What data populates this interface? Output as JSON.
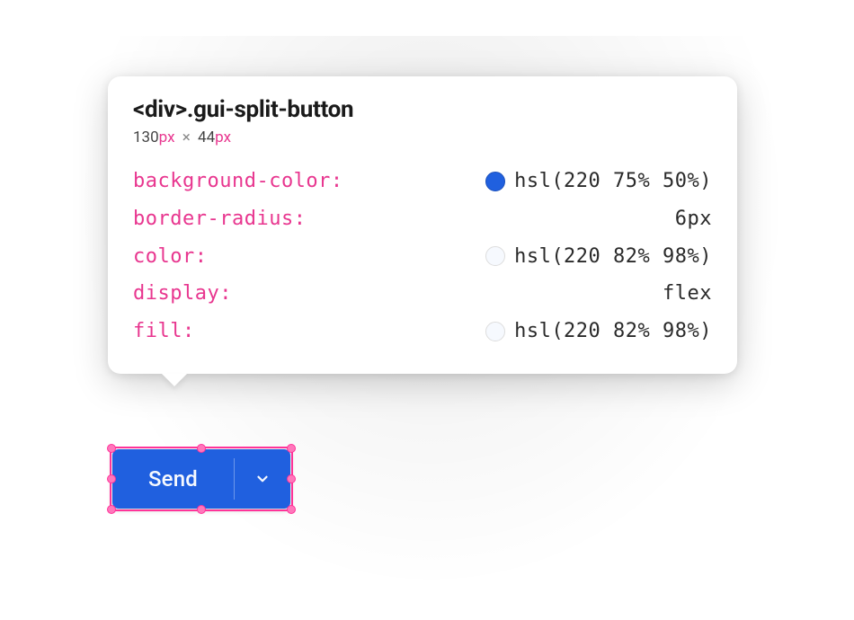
{
  "tooltip": {
    "selector": "<div>.gui-split-button",
    "width_num": "130",
    "width_unit": "px",
    "times": "×",
    "height_num": "44",
    "height_unit": "px",
    "props": [
      {
        "name": "background-color",
        "value": "hsl(220 75% 50%)",
        "swatch": "blue"
      },
      {
        "name": "border-radius",
        "value": "6px",
        "swatch": null
      },
      {
        "name": "color",
        "value": "hsl(220 82% 98%)",
        "swatch": "white"
      },
      {
        "name": "display",
        "value": "flex",
        "swatch": null
      },
      {
        "name": "fill",
        "value": "hsl(220 82% 98%)",
        "swatch": "white"
      }
    ]
  },
  "button": {
    "label": "Send"
  },
  "colors": {
    "selection": "#ff3399",
    "button_bg": "hsl(220 75% 50%)",
    "button_text": "hsl(220 82% 98%)"
  }
}
